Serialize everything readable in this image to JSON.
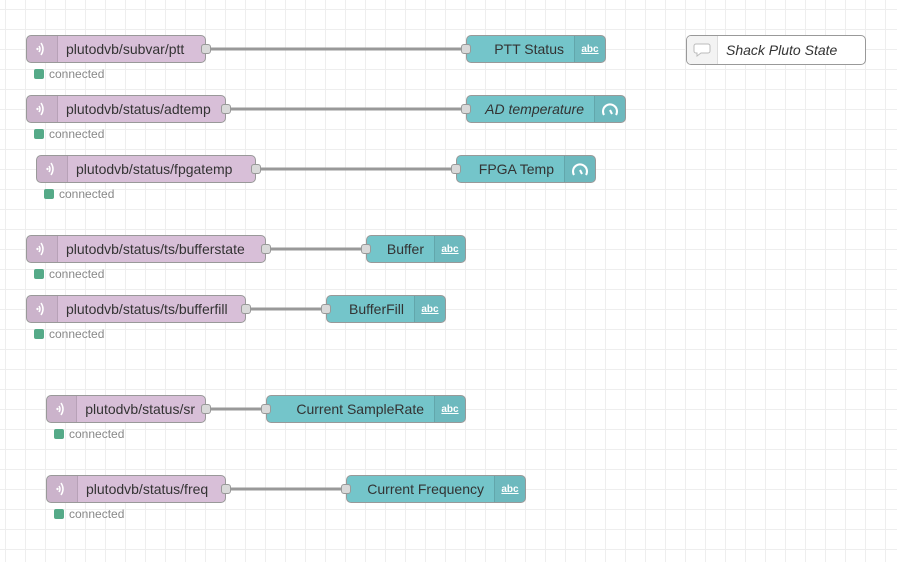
{
  "flows": [
    {
      "input": {
        "topic": "plutodvb/subvar/ptt",
        "status": "connected",
        "icon": "mqtt-in-icon"
      },
      "output": {
        "label": "PTT Status",
        "italic": false,
        "icon": "text-abc-icon"
      }
    },
    {
      "input": {
        "topic": "plutodvb/status/adtemp",
        "status": "connected",
        "icon": "mqtt-in-icon"
      },
      "output": {
        "label": "AD temperature",
        "italic": true,
        "icon": "gauge-icon"
      }
    },
    {
      "input": {
        "topic": "plutodvb/status/fpgatemp",
        "status": "connected",
        "icon": "mqtt-in-icon"
      },
      "output": {
        "label": "FPGA Temp",
        "italic": false,
        "icon": "gauge-icon"
      }
    },
    {
      "input": {
        "topic": "plutodvb/status/ts/bufferstate",
        "status": "connected",
        "icon": "mqtt-in-icon"
      },
      "output": {
        "label": "Buffer",
        "italic": false,
        "icon": "text-abc-icon"
      }
    },
    {
      "input": {
        "topic": "plutodvb/status/ts/bufferfill",
        "status": "connected",
        "icon": "mqtt-in-icon"
      },
      "output": {
        "label": "BufferFill",
        "italic": false,
        "icon": "text-abc-icon"
      }
    },
    {
      "input": {
        "topic": "plutodvb/status/sr",
        "status": "connected",
        "icon": "mqtt-in-icon"
      },
      "output": {
        "label": "Current SampleRate",
        "italic": false,
        "icon": "text-abc-icon"
      }
    },
    {
      "input": {
        "topic": "plutodvb/status/freq",
        "status": "connected",
        "icon": "mqtt-in-icon"
      },
      "output": {
        "label": "Current Frequency",
        "italic": false,
        "icon": "text-abc-icon"
      }
    }
  ],
  "comment": {
    "label": "Shack Pluto State",
    "icon": "comment-icon"
  },
  "icon_text": {
    "abc": "abc"
  },
  "colors": {
    "mqtt_node": "#d8bfd8",
    "ui_node": "#74c5ca",
    "status_connected": "#55aa88",
    "wire": "#999999"
  }
}
